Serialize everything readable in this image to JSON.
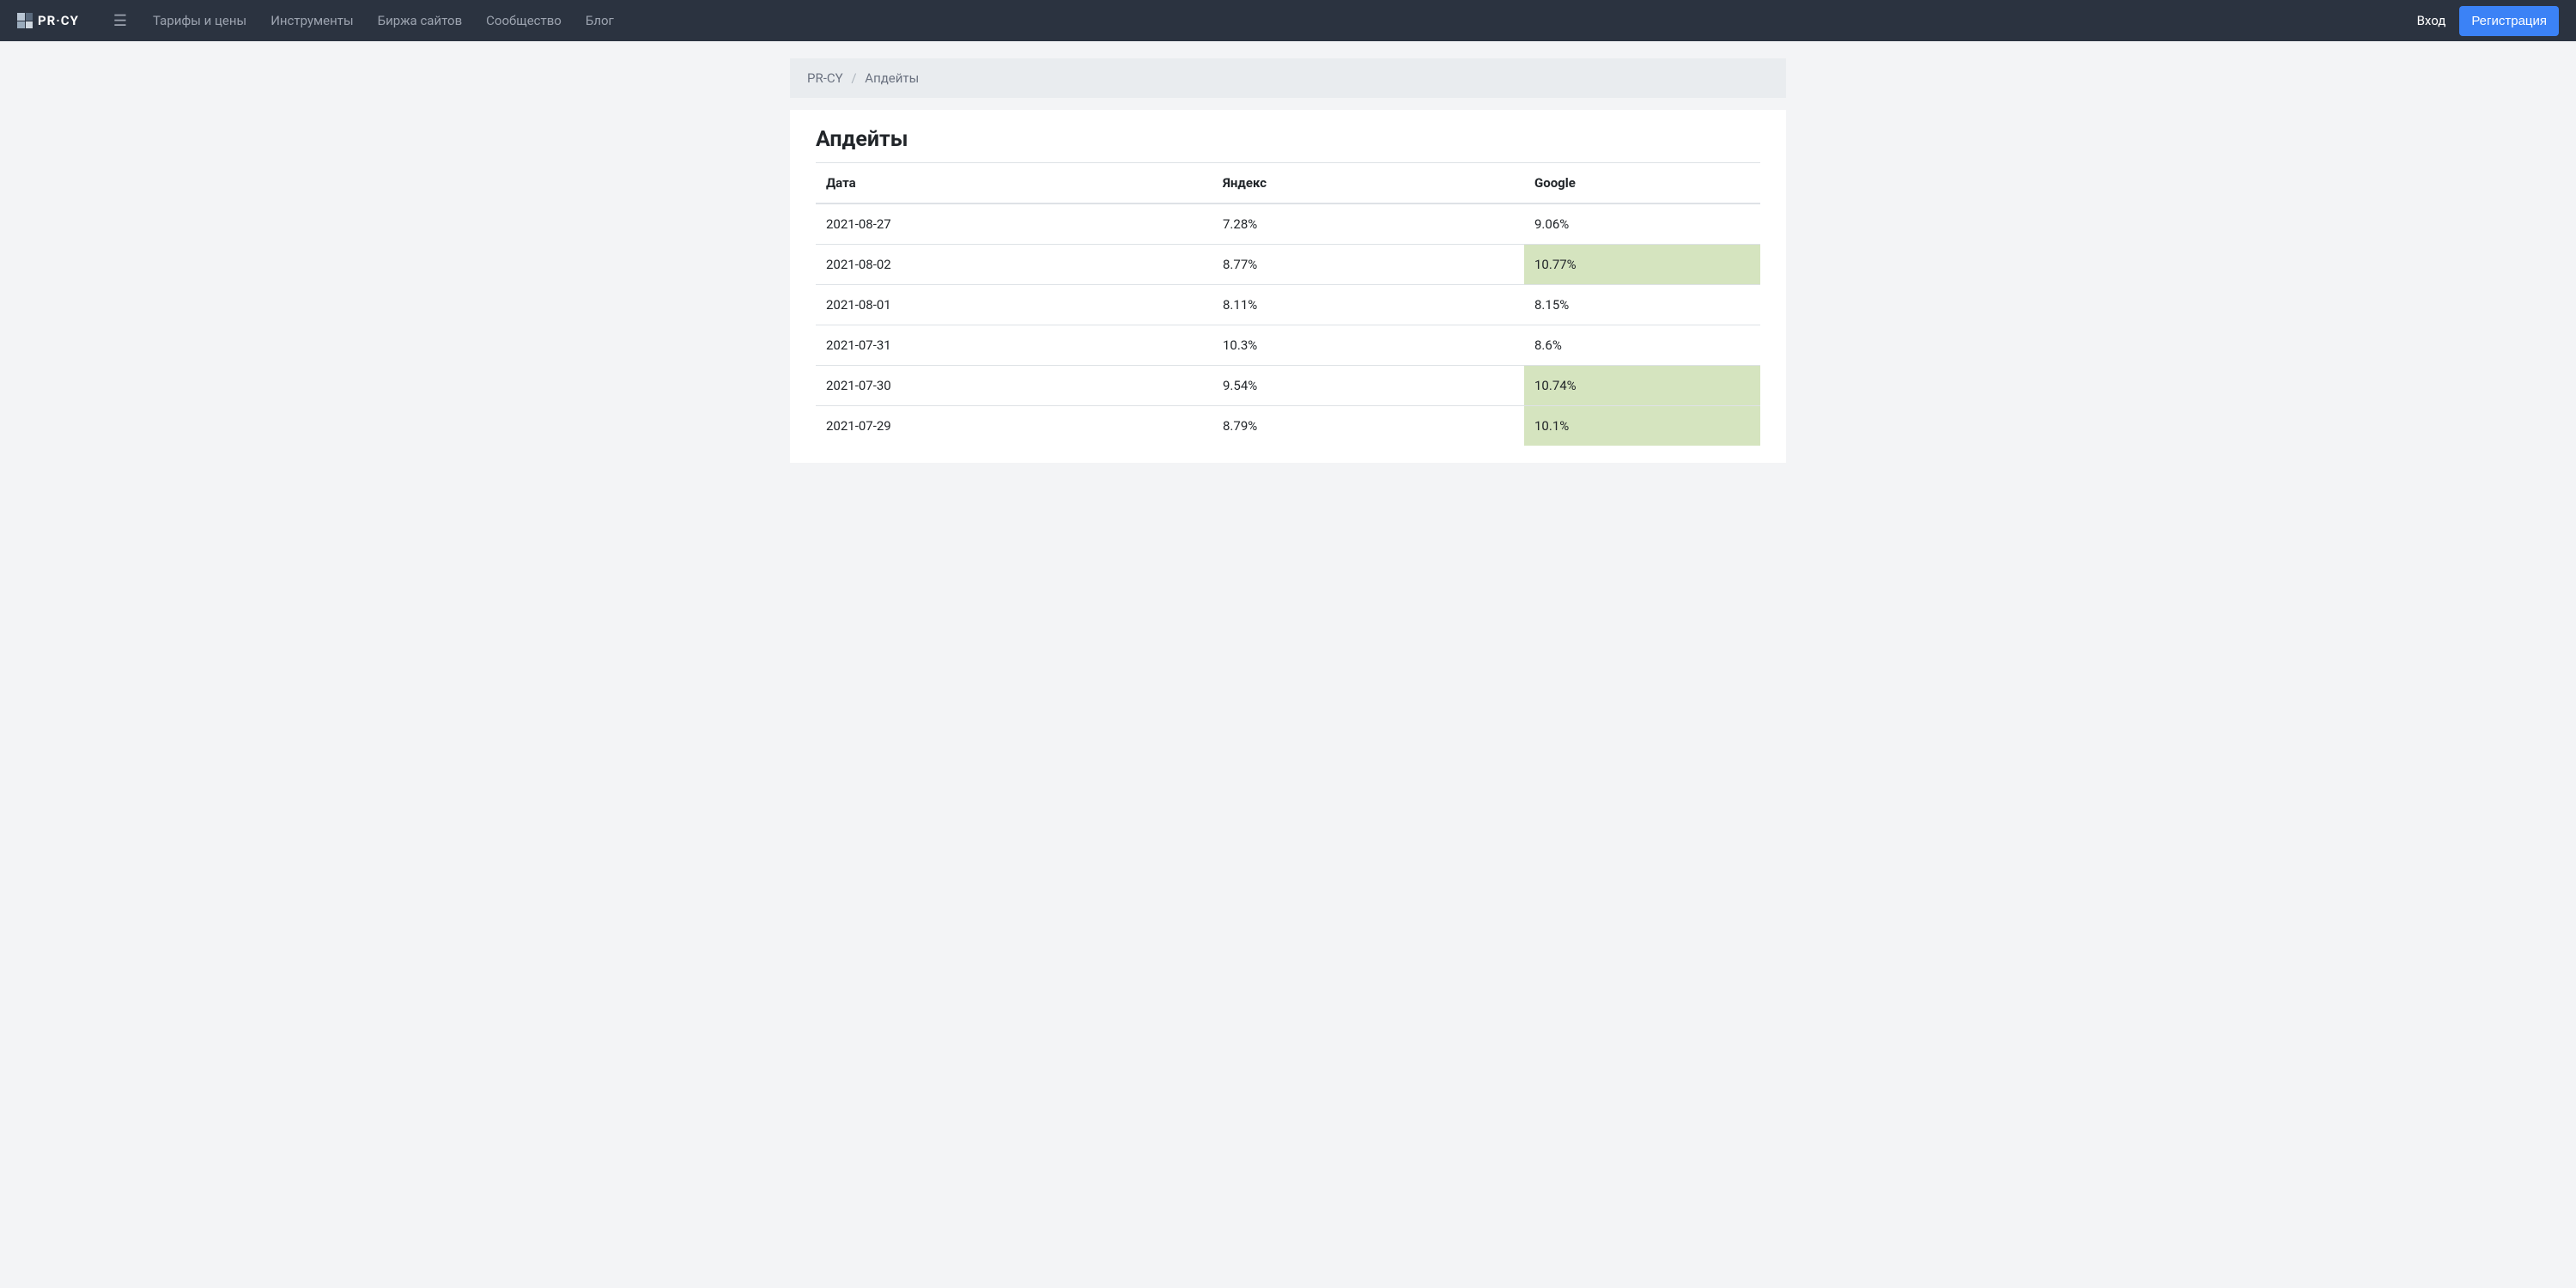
{
  "header": {
    "logo_text": "PR·CY",
    "nav": [
      "Тарифы и цены",
      "Инструменты",
      "Биржа сайтов",
      "Сообщество",
      "Блог"
    ],
    "login": "Вход",
    "register": "Регистрация"
  },
  "breadcrumb": {
    "root": "PR-CY",
    "current": "Апдейты"
  },
  "page_title": "Апдейты",
  "table": {
    "headers": [
      "Дата",
      "Яндекс",
      "Google"
    ],
    "rows": [
      {
        "date": "2021-08-27",
        "yandex": "7.28%",
        "google": "9.06%",
        "yandex_hl": false,
        "google_hl": false
      },
      {
        "date": "2021-08-02",
        "yandex": "8.77%",
        "google": "10.77%",
        "yandex_hl": false,
        "google_hl": true
      },
      {
        "date": "2021-08-01",
        "yandex": "8.11%",
        "google": "8.15%",
        "yandex_hl": false,
        "google_hl": false
      },
      {
        "date": "2021-07-31",
        "yandex": "10.3%",
        "google": "8.6%",
        "yandex_hl": false,
        "google_hl": false
      },
      {
        "date": "2021-07-30",
        "yandex": "9.54%",
        "google": "10.74%",
        "yandex_hl": false,
        "google_hl": true
      },
      {
        "date": "2021-07-29",
        "yandex": "8.79%",
        "google": "10.1%",
        "yandex_hl": false,
        "google_hl": true
      }
    ]
  }
}
